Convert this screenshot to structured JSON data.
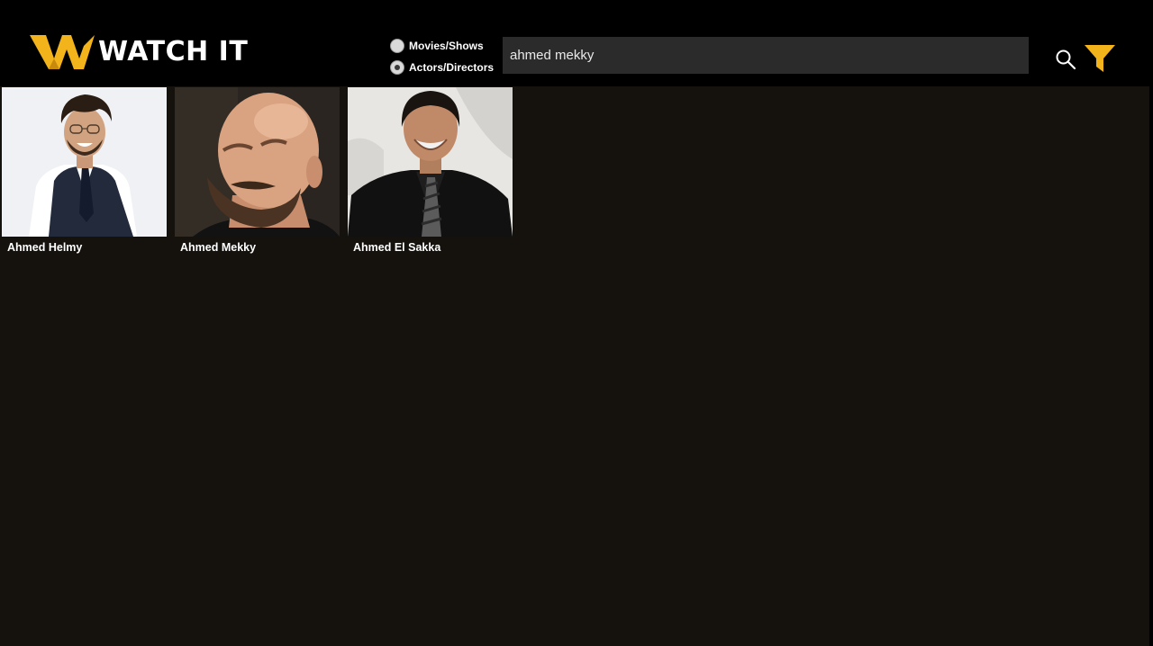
{
  "header": {
    "logo_text": "WATCH IT",
    "brand_color": "#f2b31b",
    "search_type": {
      "options": [
        {
          "label": "Movies/Shows",
          "checked": false
        },
        {
          "label": "Actors/Directors",
          "checked": true
        }
      ]
    },
    "search": {
      "value": "ahmed mekky"
    },
    "search_icon": "search-icon",
    "filter_icon": "filter-icon"
  },
  "results": [
    {
      "name": "Ahmed Helmy"
    },
    {
      "name": "Ahmed Mekky"
    },
    {
      "name": "Ahmed El Sakka"
    }
  ]
}
